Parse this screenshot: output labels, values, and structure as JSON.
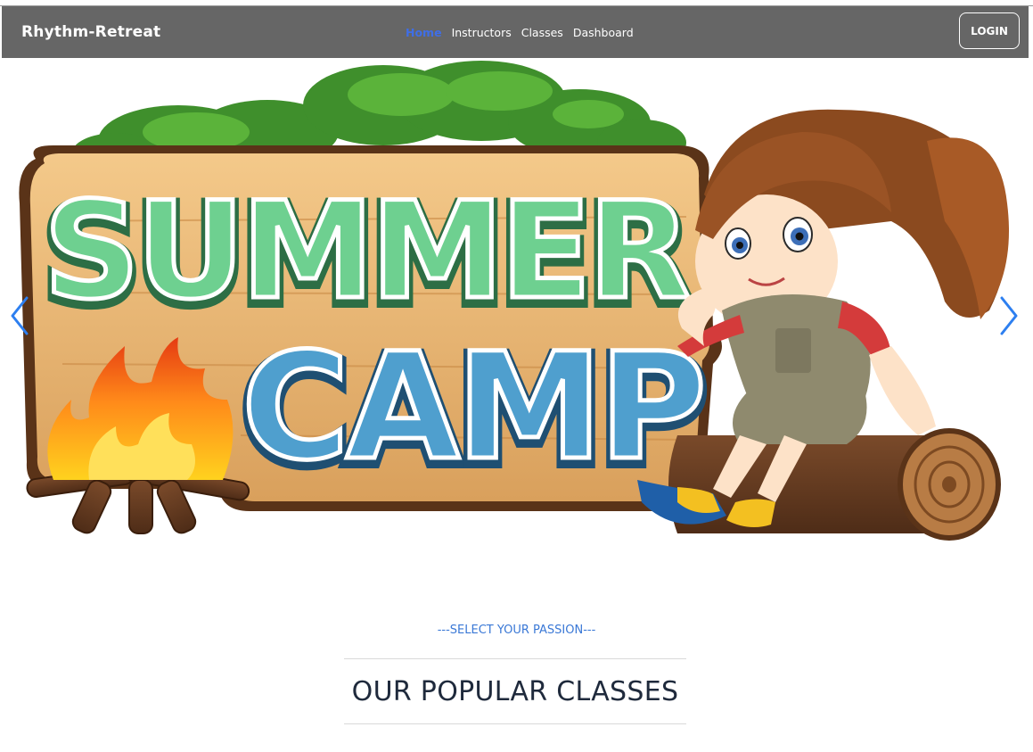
{
  "brand": "Rhythm-Retreat",
  "nav": {
    "links": [
      "Home",
      "Instructors",
      "Classes",
      "Dashboard"
    ],
    "active": "Home",
    "login_label": "LOGIN"
  },
  "hero": {
    "sign_line1": "SUMMER",
    "sign_line2": "CAMP"
  },
  "section": {
    "tagline": "---SELECT YOUR PASSION---",
    "heading": "OUR POPULAR CLASSES"
  },
  "colors": {
    "navbar": "#666666",
    "active_link": "#3f6ee6",
    "tagline": "#3a78d6",
    "heading": "#1f2a3c",
    "carousel_arrow": "#2d7ff0"
  }
}
